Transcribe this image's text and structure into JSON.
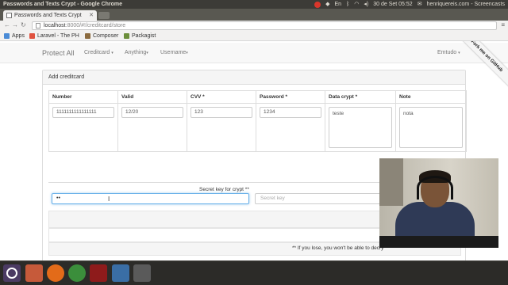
{
  "os": {
    "window_title": "Passwords and Texts Crypt - Google Chrome",
    "clock": "30 de Set 05:52",
    "user": "henriquereis.com - Screencasts"
  },
  "browser": {
    "tab_title": "Passwords and Texts Crypt",
    "url_host": "localhost",
    "url_path": ":8000/#!/creditcard/store",
    "bookmarks": [
      {
        "label": "Apps",
        "color": "#4a8bd6"
      },
      {
        "label": "Laravel - The PH",
        "color": "#e0523f"
      },
      {
        "label": "Composer",
        "color": "#8c6b3f"
      },
      {
        "label": "Packagist",
        "color": "#6b8e3a"
      }
    ]
  },
  "navbar": {
    "brand": "Protect All",
    "links": [
      "Creditcard",
      "Anything",
      "Username"
    ],
    "right_link": "Emtudo",
    "ribbon": "Fork me on GitHub"
  },
  "panel": {
    "heading": "Add creditcard",
    "columns": [
      "Number",
      "Valid",
      "CVV *",
      "Password *",
      "Data crypt *",
      "Note"
    ],
    "values": {
      "number": "1111111111111111",
      "valid": "12/20",
      "cvv": "123",
      "password": "1234",
      "data_crypt": "teste",
      "note": "nota"
    },
    "secret_label": "Secret key for crypt **",
    "secret_value": "••",
    "secret_placeholder": "Secret key",
    "footnote": "** If you lose, you won't be able to decry"
  },
  "colors": {
    "focus": "#66afe9",
    "ubuntu_bar": "#3c3b37"
  }
}
